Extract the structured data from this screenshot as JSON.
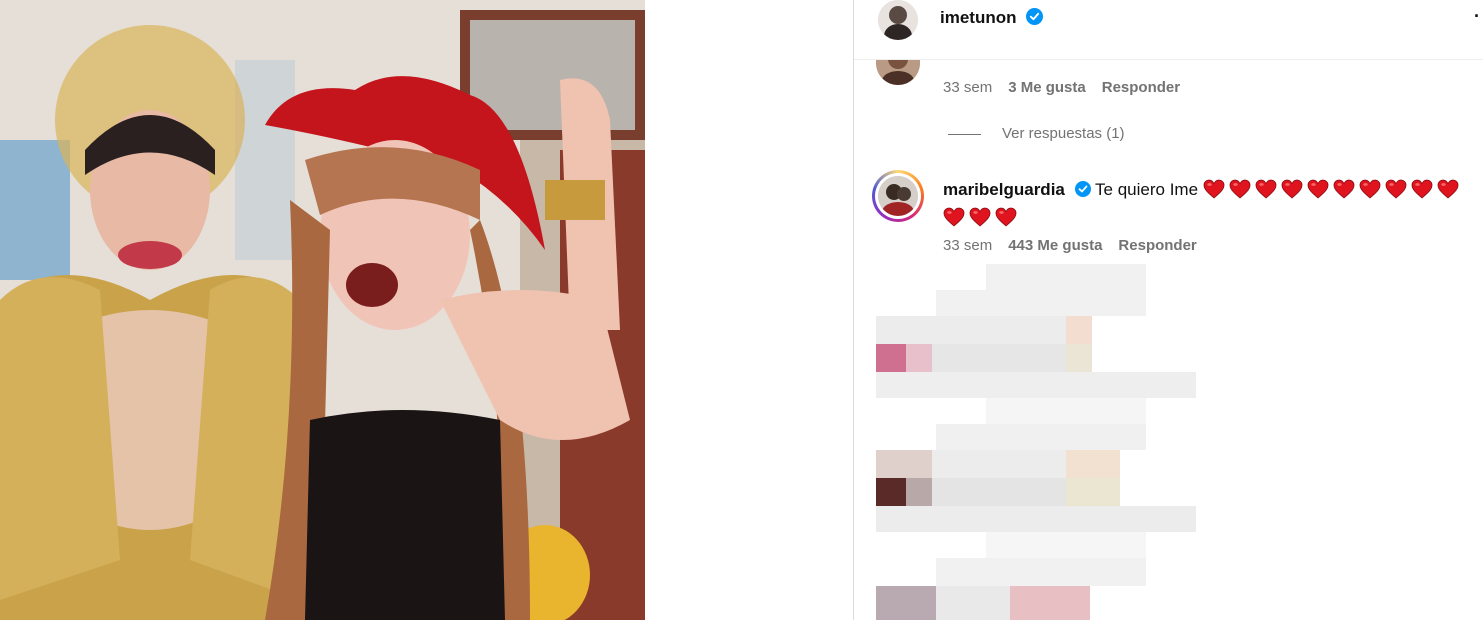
{
  "header": {
    "username": "imetunon",
    "more": "·"
  },
  "comments": [
    {
      "time": "33 sem",
      "likes": "3 Me gusta",
      "reply": "Responder"
    },
    {
      "view_replies": "Ver respuestas (1)"
    },
    {
      "username": "maribelguardia",
      "text": "Te quiero Ime",
      "time": "33 sem",
      "likes": "443 Me gusta",
      "reply": "Responder"
    }
  ],
  "colors": {
    "verified": "#0095f6",
    "heart": "#e0141e",
    "meta_text": "#737373"
  },
  "icons": [
    "verified-badge-icon",
    "heart-emoji-icon",
    "more-options-icon"
  ]
}
